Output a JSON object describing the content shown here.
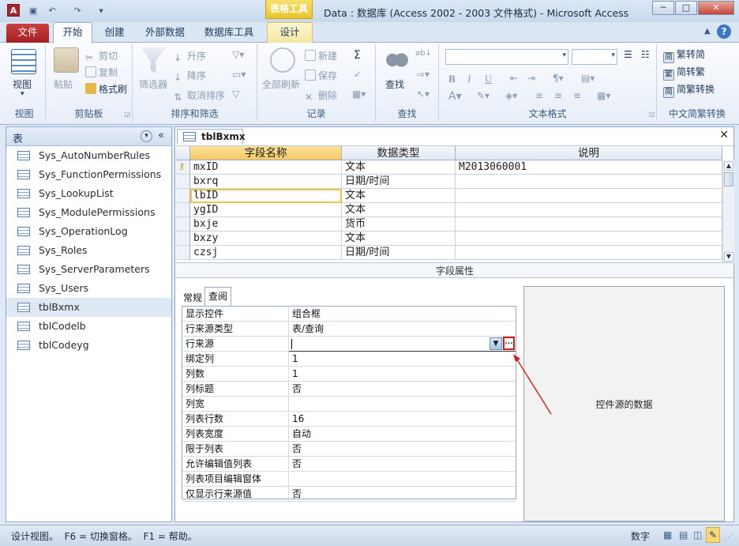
{
  "title": {
    "window_title": "Data : 数据库 (Access 2002 - 2003 文件格式) - Microsoft Access",
    "context_tab": "表格工具"
  },
  "tabs": [
    "文件",
    "开始",
    "创建",
    "外部数据",
    "数据库工具",
    "设计"
  ],
  "ribbon": {
    "view": {
      "label": "视图",
      "group": "视图"
    },
    "clipboard": {
      "paste": "粘贴",
      "cut": "剪切",
      "copy": "复制",
      "format_painter": "格式刷",
      "group": "剪贴板"
    },
    "sort_filter": {
      "filter": "筛选器",
      "asc": "升序",
      "desc": "降序",
      "clear_sort": "取消排序",
      "group": "排序和筛选"
    },
    "records": {
      "refresh_all": "全部刷新",
      "new": "新建",
      "save": "保存",
      "delete": "删除",
      "group": "记录"
    },
    "find": {
      "find": "查找",
      "group": "查找"
    },
    "text_format": {
      "group": "文本格式",
      "bold": "B",
      "italic": "I",
      "underline": "U"
    },
    "chinese_convert": {
      "to_simplified": "繁转简",
      "to_traditional": "简转繁",
      "convert": "简繁转换",
      "group": "中文简繁转换"
    }
  },
  "nav": {
    "title": "表",
    "items": [
      "Sys_AutoNumberRules",
      "Sys_FunctionPermissions",
      "Sys_LookupList",
      "Sys_ModulePermissions",
      "Sys_OperationLog",
      "Sys_Roles",
      "Sys_ServerParameters",
      "Sys_Users",
      "tblBxmx",
      "tblCodelb",
      "tblCodeyg"
    ]
  },
  "doc": {
    "tab": "tblBxmx",
    "columns": [
      "字段名称",
      "数据类型",
      "说明"
    ],
    "rows": [
      {
        "name": "mxID",
        "type": "文本",
        "desc": "M2013060001"
      },
      {
        "name": "bxrq",
        "type": "日期/时间",
        "desc": ""
      },
      {
        "name": "lbID",
        "type": "文本",
        "desc": ""
      },
      {
        "name": "ygID",
        "type": "文本",
        "desc": ""
      },
      {
        "name": "bxje",
        "type": "货币",
        "desc": ""
      },
      {
        "name": "bxzy",
        "type": "文本",
        "desc": ""
      },
      {
        "name": "czsj",
        "type": "日期/时间",
        "desc": ""
      }
    ],
    "field_props_label": "字段属性",
    "prop_tabs": [
      "常规",
      "查阅"
    ],
    "props": [
      {
        "name": "显示控件",
        "value": "组合框"
      },
      {
        "name": "行来源类型",
        "value": "表/查询"
      },
      {
        "name": "行来源",
        "value": ""
      },
      {
        "name": "绑定列",
        "value": "1"
      },
      {
        "name": "列数",
        "value": "1"
      },
      {
        "name": "列标题",
        "value": "否"
      },
      {
        "name": "列宽",
        "value": ""
      },
      {
        "name": "列表行数",
        "value": "16"
      },
      {
        "name": "列表宽度",
        "value": "自动"
      },
      {
        "name": "限于列表",
        "value": "否"
      },
      {
        "name": "允许编辑值列表",
        "value": "否"
      },
      {
        "name": "列表项目编辑窗体",
        "value": ""
      },
      {
        "name": "仅显示行来源值",
        "value": "否"
      }
    ],
    "help_text": "控件源的数据"
  },
  "status": {
    "left": "设计视图。  F6 = 切换窗格。  F1 = 帮助。",
    "right": "数字"
  },
  "colors": {
    "accent_red": "#d11a1a",
    "file_tab": "#b5282d",
    "context": "#ecc938"
  }
}
